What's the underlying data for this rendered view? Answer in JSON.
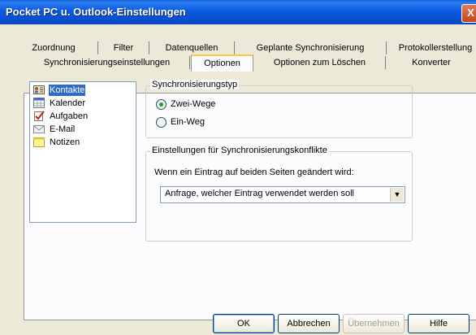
{
  "window": {
    "title": "Pocket PC u. Outlook-Einstellungen",
    "close_glyph": "X"
  },
  "tabs_row1": [
    {
      "label": "Zuordnung"
    },
    {
      "label": "Filter"
    },
    {
      "label": "Datenquellen"
    },
    {
      "label": "Geplante Synchronisierung"
    },
    {
      "label": "Protokollerstellung"
    }
  ],
  "tabs_row2": [
    {
      "label": "Synchronisierungseinstellungen"
    },
    {
      "label": "Optionen",
      "active": true
    },
    {
      "label": "Optionen zum Löschen"
    },
    {
      "label": "Konverter"
    }
  ],
  "item_list": [
    {
      "label": "Kontakte",
      "icon": "contacts-icon",
      "selected": true
    },
    {
      "label": "Kalender",
      "icon": "calendar-icon"
    },
    {
      "label": "Aufgaben",
      "icon": "tasks-icon"
    },
    {
      "label": "E-Mail",
      "icon": "email-icon"
    },
    {
      "label": "Notizen",
      "icon": "notes-icon"
    }
  ],
  "sync_type": {
    "legend": "Synchronisierungstyp",
    "options": [
      {
        "label": "Zwei-Wege",
        "checked": true
      },
      {
        "label": "Ein-Weg",
        "checked": false
      }
    ]
  },
  "conflicts": {
    "legend": "Einstellungen für Synchronisierungskonflikte",
    "prompt": "Wenn ein Eintrag auf beiden Seiten geändert wird:",
    "selected_value": "Anfrage, welcher Eintrag verwendet werden soll"
  },
  "buttons": {
    "ok": "OK",
    "cancel": "Abbrechen",
    "apply": "Übernehmen",
    "help": "Hilfe"
  },
  "colors": {
    "titlebar": "#0650d0",
    "selection": "#316ac5",
    "dialog_bg": "#ece9d8",
    "tab_highlight": "#ffc83c"
  }
}
